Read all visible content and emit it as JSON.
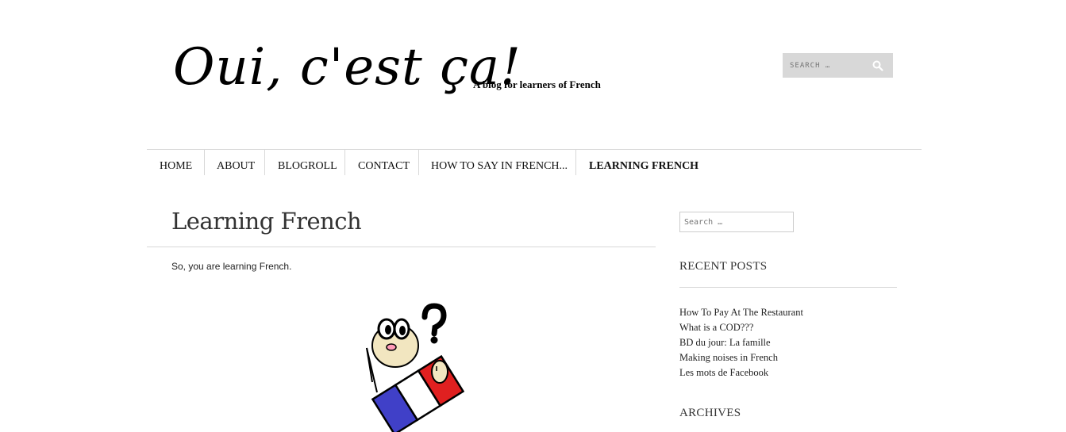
{
  "header": {
    "logo_text": "Oui, c'est ça!",
    "tagline": "A blog for learners of French",
    "search_placeholder": "SEARCH …"
  },
  "nav": {
    "items": [
      {
        "label": "HOME"
      },
      {
        "label": "ABOUT"
      },
      {
        "label": "BLOGROLL"
      },
      {
        "label": "CONTACT"
      },
      {
        "label": "HOW TO SAY IN FRENCH..."
      },
      {
        "label": "LEARNING FRENCH",
        "active": true
      }
    ]
  },
  "main": {
    "title": "Learning French",
    "intro": "So, you are learning French.",
    "illustration": {
      "description_icon": "confused-character-with-french-flag-icon",
      "flag_colors": [
        "#4040c8",
        "#ffffff",
        "#e02020"
      ],
      "skin_color": "#f2e6c0"
    }
  },
  "sidebar": {
    "search_placeholder": "Search …",
    "recent_posts_title": "RECENT POSTS",
    "recent_posts": [
      "How To Pay At The Restaurant",
      "What is a COD???",
      "BD du jour: La famille",
      "Making noises in French",
      "Les mots de Facebook"
    ],
    "archives_title": "ARCHIVES"
  },
  "colors": {
    "rule": "#d8d8d8",
    "header_search_bg": "#d8d8d8",
    "text": "#222222"
  }
}
